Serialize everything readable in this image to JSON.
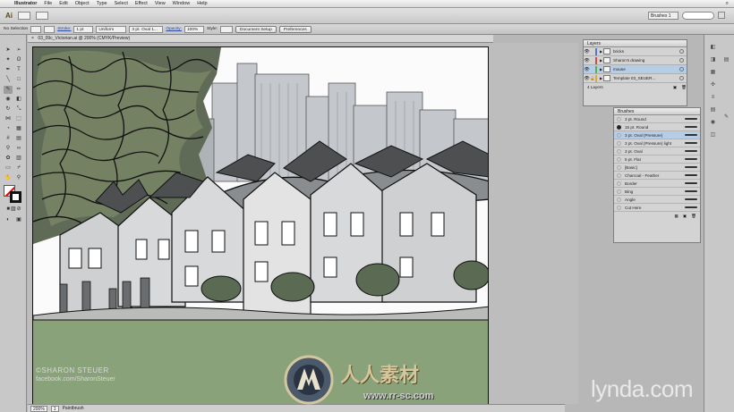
{
  "menubar": {
    "apple_icon": "apple-icon",
    "app_name": "Illustrator",
    "items": [
      "File",
      "Edit",
      "Object",
      "Type",
      "Select",
      "Effect",
      "View",
      "Window",
      "Help"
    ]
  },
  "appbar": {
    "logo": "Ai",
    "workspace": "Brushes 1"
  },
  "controlbar": {
    "selection": "No Selection",
    "stroke_label": "Stroke:",
    "stroke_weight": "1 pt",
    "uniform": "Uniform",
    "brush": "3 pt. Oval 1...",
    "opacity_label": "Opacity:",
    "opacity": "100%",
    "style_label": "Style:",
    "document_setup": "Document Setup",
    "preferences": "Preferences"
  },
  "document": {
    "tab_title": "03_09c_Victorian.ai @ 200% (CMYK/Preview)"
  },
  "artwork": {
    "credit_name": "©SHARON STEUER",
    "credit_url": "facebook.com/SharonSteuer"
  },
  "statusbar": {
    "zoom": "200%",
    "page": "1",
    "tool": "Paintbrush"
  },
  "layers_panel": {
    "title": "Layers",
    "rows": [
      {
        "name": "bricks",
        "color": "#4a7cd6",
        "active": false
      },
      {
        "name": "Sharon's drawing",
        "color": "#d64a4a",
        "active": false
      },
      {
        "name": "mouse",
        "color": "#4ab84a",
        "active": true
      },
      {
        "name": "Template 03_SEUER...",
        "color": "#d6a84a",
        "active": false
      }
    ],
    "footer": "4 Layers"
  },
  "brushes_panel": {
    "title": "Brushes",
    "rows": [
      {
        "name": "3 pt. Round",
        "filled": false,
        "active": false
      },
      {
        "name": "15 pt. Round",
        "filled": true,
        "active": false
      },
      {
        "name": "3 pt. Oval (Pressure)",
        "filled": false,
        "active": true
      },
      {
        "name": "3 pt. Oval (Pressure) light",
        "filled": false,
        "active": false
      },
      {
        "name": "3 pt. Oval",
        "filled": false,
        "active": false
      },
      {
        "name": "5 pt. Flat",
        "filled": false,
        "active": false
      },
      {
        "name": "[Basic]",
        "filled": false,
        "active": false
      },
      {
        "name": "Charcoal - Feather",
        "filled": false,
        "active": false
      },
      {
        "name": "Border",
        "filled": false,
        "active": false
      },
      {
        "name": "Bing",
        "filled": false,
        "active": false
      },
      {
        "name": "Angle",
        "filled": false,
        "active": false
      },
      {
        "name": "Cut Here",
        "filled": false,
        "active": false
      }
    ]
  },
  "watermarks": {
    "lynda": "lynda.com",
    "cn_text": "人人素材",
    "cn_url": "www.rr-sc.com"
  }
}
